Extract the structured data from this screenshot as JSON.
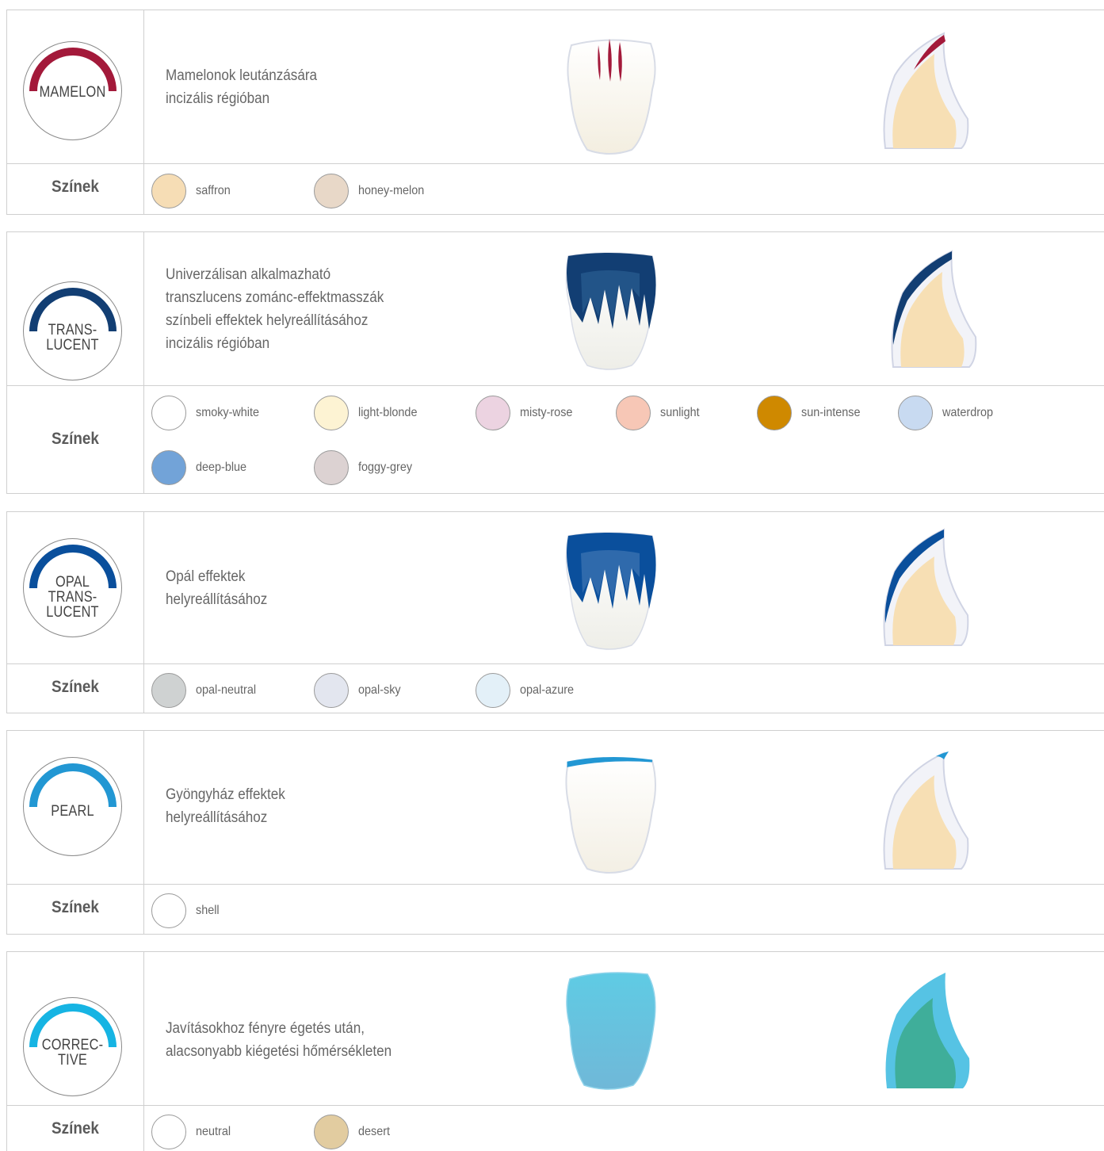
{
  "colors_label": "Színek",
  "sections": [
    {
      "badge_lines": [
        "MAMELON"
      ],
      "accent": "#a3193a",
      "description": [
        "Mamelonok leutánzására",
        "incizális régióban"
      ],
      "swatches": [
        {
          "name": "saffron",
          "color": "#f6ddb5"
        },
        {
          "name": "honey-melon",
          "color": "#e8d8c8"
        }
      ]
    },
    {
      "badge_lines": [
        "TRANS-",
        "LUCENT"
      ],
      "accent": "#123e73",
      "description": [
        "Univerzálisan alkalmazható",
        "transzlucens zománc-effektmasszák",
        "színbeli effektek helyreállításához",
        "incizális régióban"
      ],
      "swatches": [
        {
          "name": "smoky-white",
          "color": "#ffffff"
        },
        {
          "name": "light-blonde",
          "color": "#fdf3d3"
        },
        {
          "name": "misty-rose",
          "color": "#ecd3e1"
        },
        {
          "name": "sunlight",
          "color": "#f7c7b6"
        },
        {
          "name": "sun-intense",
          "color": "#cf8900"
        },
        {
          "name": "waterdrop",
          "color": "#c8daf1"
        },
        {
          "name": "deep-blue",
          "color": "#72a3d8"
        },
        {
          "name": "foggy-grey",
          "color": "#dcd2d2"
        }
      ]
    },
    {
      "badge_lines": [
        "OPAL",
        "TRANS-",
        "LUCENT"
      ],
      "accent": "#0a4f9c",
      "description": [
        "Opál effektek",
        "helyreállításához"
      ],
      "swatches": [
        {
          "name": "opal-neutral",
          "color": "#cfd2d2"
        },
        {
          "name": "opal-sky",
          "color": "#e3e6ef"
        },
        {
          "name": "opal-azure",
          "color": "#e3f0f8"
        }
      ]
    },
    {
      "badge_lines": [
        "PEARL"
      ],
      "accent": "#2297d3",
      "description": [
        "Gyöngyház effektek",
        "helyreállításához"
      ],
      "swatches": [
        {
          "name": "shell",
          "color": "#ffffff"
        }
      ]
    },
    {
      "badge_lines": [
        "CORREC-",
        "TIVE"
      ],
      "accent": "#16b4e3",
      "description": [
        "Javításokhoz fényre égetés után,",
        "alacsonyabb kiégetési hőmérsékleten"
      ],
      "swatches": [
        {
          "name": "neutral",
          "color": "#ffffff"
        },
        {
          "name": "desert",
          "color": "#e2cca0"
        }
      ]
    }
  ]
}
